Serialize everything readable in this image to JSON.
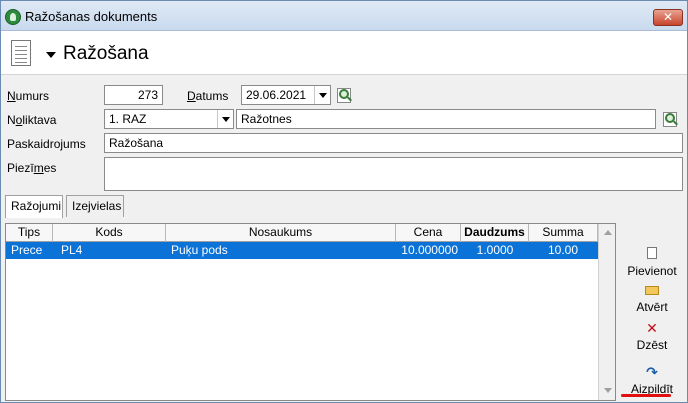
{
  "window": {
    "title": "Ražošanas dokuments",
    "close_label": "✕"
  },
  "header": {
    "heading": "Ražošana"
  },
  "form": {
    "numurs_label": "Numurs",
    "numurs_value": "273",
    "datums_label": "Datums",
    "datums_value": "29.06.2021",
    "noliktava_label": "Noliktava",
    "noliktava_code": "1. RAZ",
    "noliktava_name": "Ražotnes",
    "paskaidrojums_label": "Paskaidrojums",
    "paskaidrojums_value": "Ražošana",
    "piezimes_label": "Piezīmes",
    "piezimes_value": ""
  },
  "tabs": [
    {
      "label": "Ražojumi",
      "active": true
    },
    {
      "label": "Izejvielas",
      "active": false
    }
  ],
  "table": {
    "columns": [
      "Tips",
      "Kods",
      "Nosaukums",
      "Cena",
      "Daudzums",
      "Summa"
    ],
    "rows": [
      {
        "tips": "Prece",
        "kods": "PL4",
        "nosaukums": "Puķu pods",
        "cena": "10.000000",
        "daudzums": "1.0000",
        "summa": "10.00",
        "selected": true
      }
    ]
  },
  "actions": {
    "add_label": "Pievienot",
    "open_label": "Atvērt",
    "delete_label": "Dzēst",
    "fill_label": "Aizpildīt"
  },
  "colors": {
    "selection": "#0b73d7",
    "highlight_underline": "#e01010"
  },
  "icons": {
    "app": "app-logo-icon",
    "document": "document-icon",
    "lookup": "lookup-icon",
    "add": "new-page-icon",
    "open": "folder-open-icon",
    "delete": "delete-x-icon",
    "fill": "refresh-fill-icon"
  }
}
